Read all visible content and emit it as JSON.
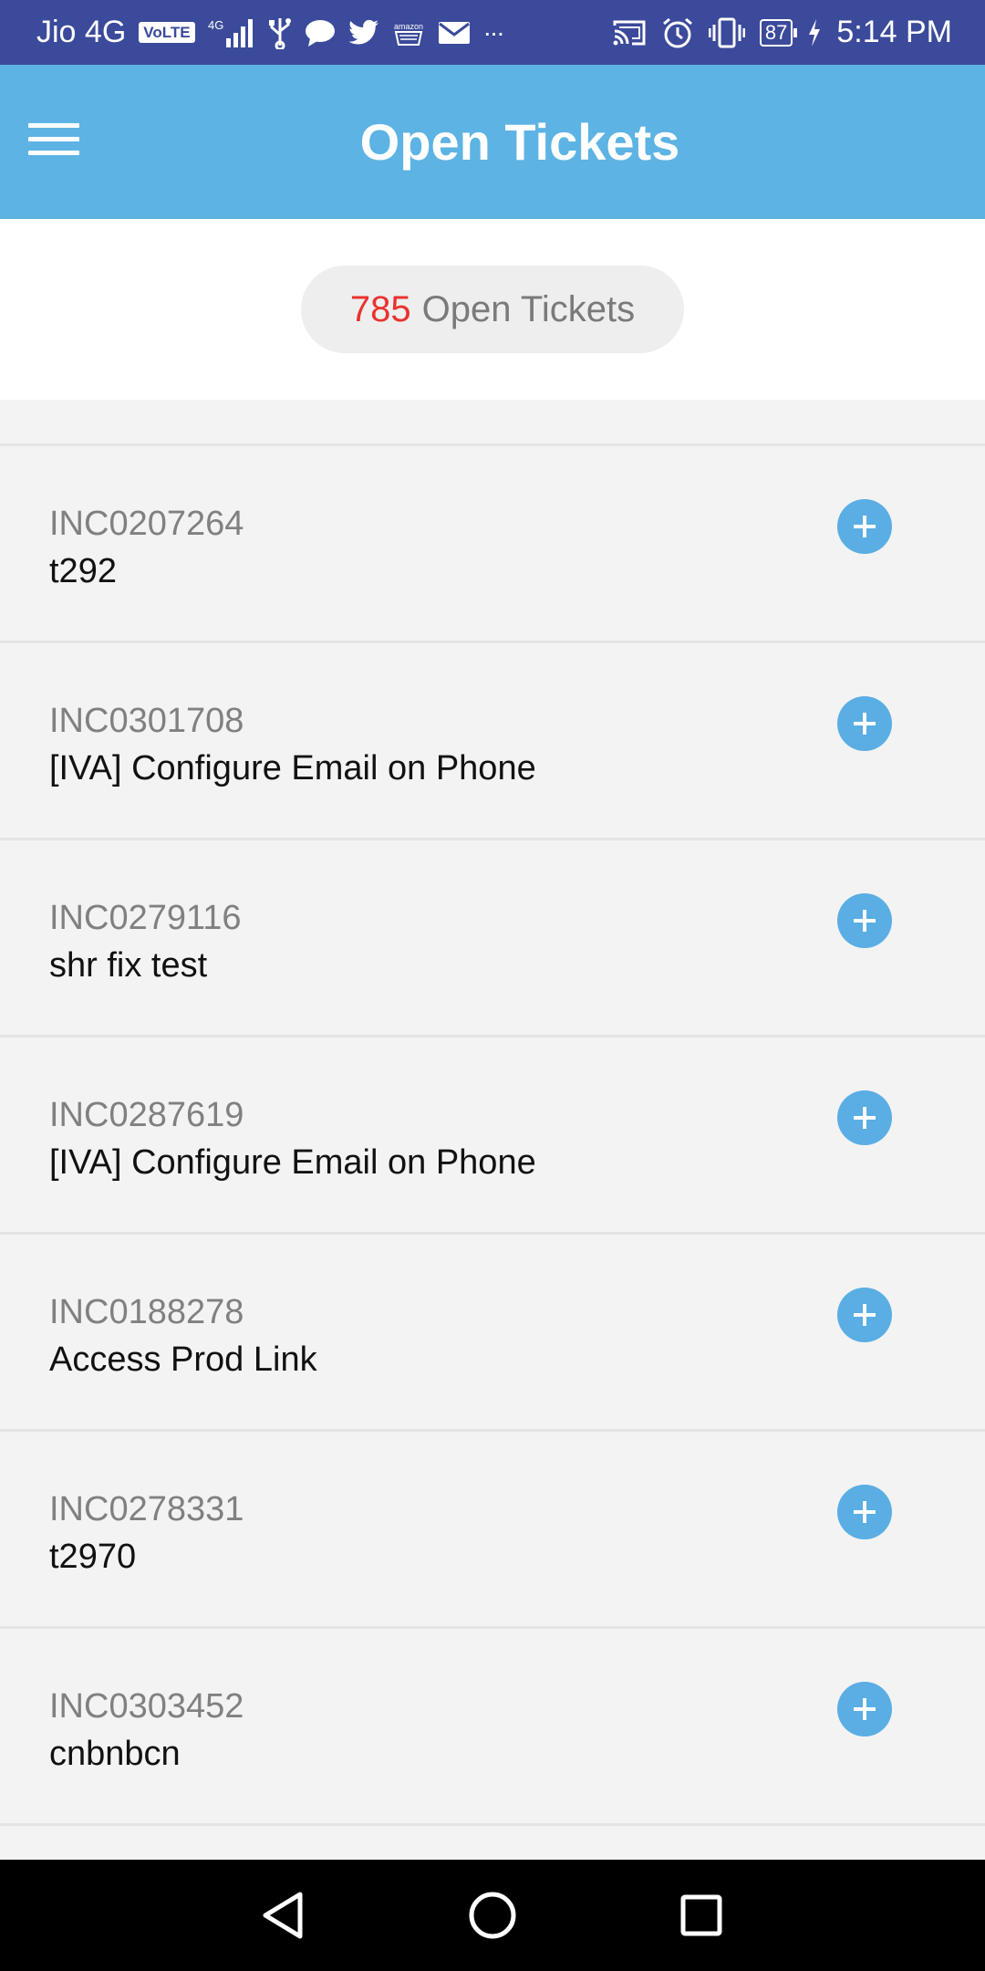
{
  "status_bar": {
    "carrier": "Jio 4G",
    "volte_badge": "VoLTE",
    "network_type": "4G",
    "battery_level": "87",
    "time": "5:14 PM",
    "more_indicator": "···",
    "left_icons": [
      "volte-icon",
      "signal-icon",
      "usb-icon",
      "chat-bubble-icon",
      "twitter-icon",
      "amazon-icon",
      "mail-icon",
      "more-icon"
    ],
    "right_icons": [
      "cast-icon",
      "alarm-icon",
      "vibrate-icon",
      "battery-icon",
      "charging-icon"
    ]
  },
  "app_bar": {
    "title": "Open Tickets",
    "menu_icon": "hamburger-menu-icon",
    "background_color": "#5db3e3"
  },
  "summary": {
    "count": "785",
    "label": "Open Tickets",
    "count_color": "#e8322f"
  },
  "tickets": [
    {
      "number": "INC0207264",
      "description": "t292"
    },
    {
      "number": "INC0301708",
      "description": "[IVA] Configure Email on Phone"
    },
    {
      "number": "INC0279116",
      "description": "shr fix test"
    },
    {
      "number": "INC0287619",
      "description": "[IVA] Configure Email on Phone"
    },
    {
      "number": "INC0188278",
      "description": "Access Prod Link"
    },
    {
      "number": "INC0278331",
      "description": "t2970"
    },
    {
      "number": "INC0303452",
      "description": "cnbnbcn"
    }
  ],
  "accent_color": "#5aaee3",
  "nav_bar": {
    "icons": [
      "back-icon",
      "home-icon",
      "recents-icon"
    ]
  }
}
